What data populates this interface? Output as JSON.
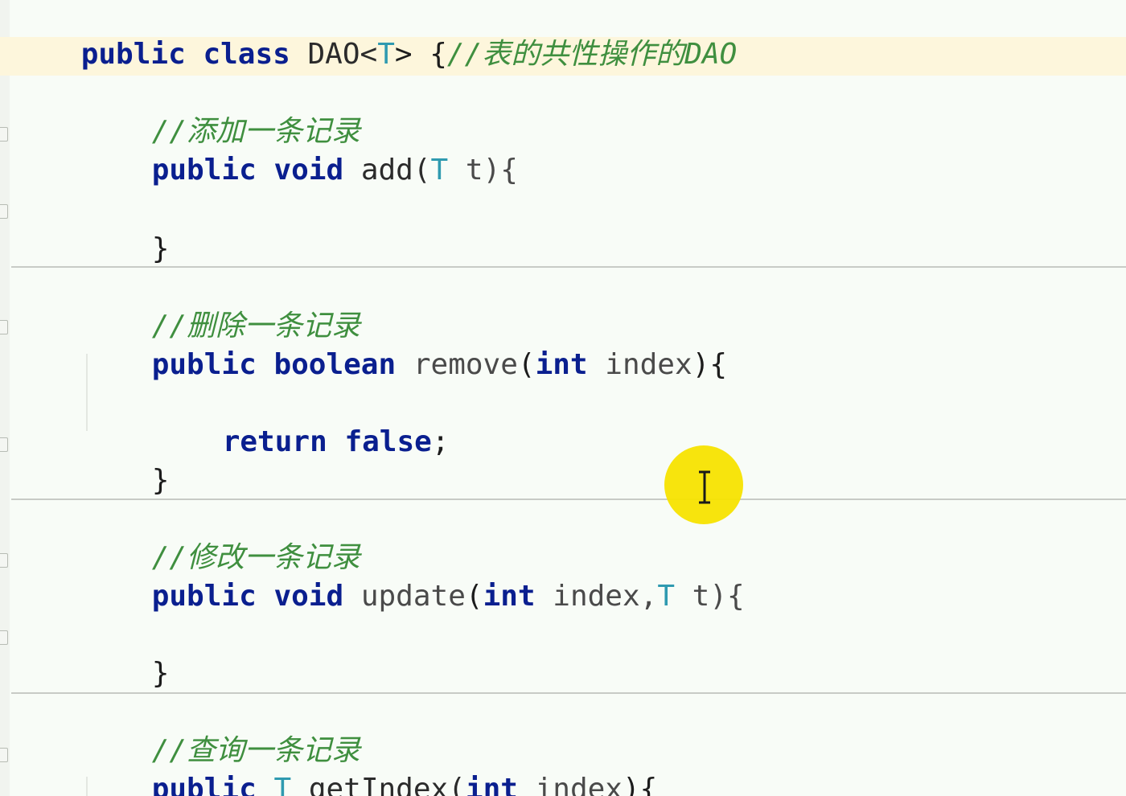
{
  "code": {
    "l1_public": "public",
    "l1_class": "class",
    "l1_name": "DAO<",
    "l1_type": "T",
    "l1_close": "> {",
    "l1_comment": "//表的共性操作的DAO",
    "l2_comment": "//添加一条记录",
    "l3_public": "public",
    "l3_void": "void",
    "l3_method": "add(",
    "l3_type": "T",
    "l3_param": " t){",
    "l4_brace": "}",
    "l5_comment": "//删除一条记录",
    "l6_public": "public",
    "l6_boolean": "boolean",
    "l6_method": "remove",
    "l6_open": "(",
    "l6_int": "int",
    "l6_param": " index",
    "l6_close": "){",
    "l7_return": "return",
    "l7_false": "false",
    "l7_semi": ";",
    "l8_brace": "}",
    "l9_comment": "//修改一条记录",
    "l10_public": "public",
    "l10_void": "void",
    "l10_method": "update",
    "l10_open": "(",
    "l10_int": "int",
    "l10_param1": " index,",
    "l10_type": "T",
    "l10_param2": " t){",
    "l11_brace": "}",
    "l12_comment": "//查询一条记录",
    "l13_public": "public",
    "l13_type": "T",
    "l13_method": "getIndex(",
    "l13_int": "int",
    "l13_param": " index",
    "l13_close": "){"
  },
  "colors": {
    "keyword": "#0a1f8f",
    "comment": "#3f8f3f",
    "type_param": "#2f9ab0",
    "current_line": "#fdf6dc",
    "cursor_highlight": "#f7e300"
  }
}
